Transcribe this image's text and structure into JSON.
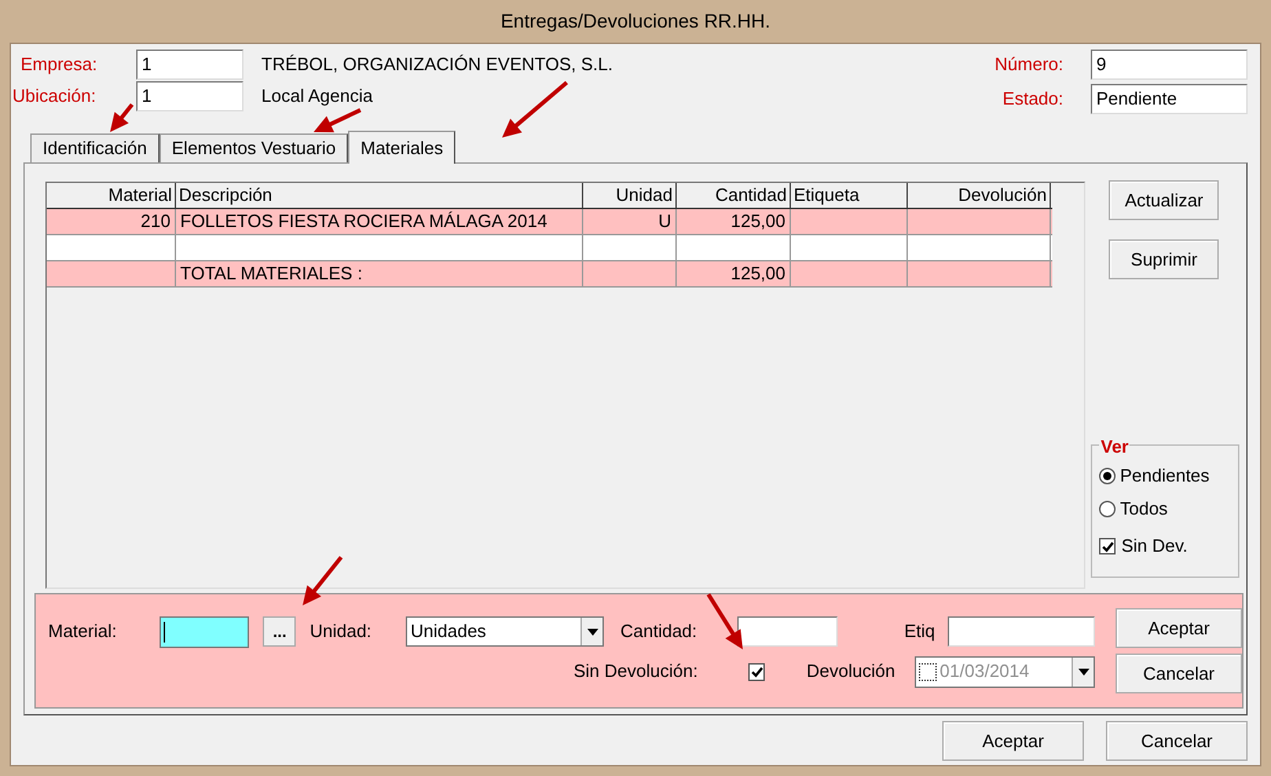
{
  "window": {
    "title": "Entregas/Devoluciones RR.HH."
  },
  "header": {
    "empresa": {
      "label": "Empresa:",
      "value": "1",
      "name": "TRÉBOL, ORGANIZACIÓN EVENTOS, S.L."
    },
    "ubicacion": {
      "label": "Ubicación:",
      "value": "1",
      "name": "Local Agencia"
    },
    "numero": {
      "label": "Número:",
      "value": "9"
    },
    "estado": {
      "label": "Estado:",
      "value": "Pendiente"
    }
  },
  "tabs": [
    {
      "label": "Identificación",
      "selected": false
    },
    {
      "label": "Elementos Vestuario",
      "selected": false
    },
    {
      "label": "Materiales",
      "selected": true
    }
  ],
  "table": {
    "columns": [
      "Material",
      "Descripción",
      "Unidad",
      "Cantidad",
      "Etiqueta",
      "Devolución"
    ],
    "rows": [
      {
        "kind": "item",
        "material": "210",
        "descripcion": "FOLLETOS FIESTA ROCIERA MÁLAGA 2014",
        "unidad": "U",
        "cantidad": "125,00"
      },
      {
        "kind": "blank"
      },
      {
        "kind": "total",
        "descripcion": "TOTAL MATERIALES :",
        "cantidad": "125,00"
      }
    ]
  },
  "side_buttons": [
    "Actualizar",
    "Suprimir"
  ],
  "ver": {
    "title": "Ver",
    "options": [
      {
        "label": "Pendientes",
        "selected": true
      },
      {
        "label": "Todos",
        "selected": false
      }
    ],
    "checkbox": {
      "label": "Sin Dev.",
      "checked": true
    }
  },
  "edit": {
    "material_label": "Material:",
    "browse": "...",
    "unidad_label": "Unidad:",
    "unidad_value": "Unidades",
    "cantidad_label": "Cantidad:",
    "etiq_label": "Etiq",
    "sin_devolucion": {
      "label": "Sin Devolución:",
      "checked": true
    },
    "devolucion": {
      "label": "Devolución",
      "value": "01/03/2014",
      "checked": false,
      "disabled": true
    },
    "buttons": [
      "Aceptar",
      "Cancelar"
    ]
  },
  "footer_buttons": [
    "Aceptar",
    "Cancelar"
  ]
}
